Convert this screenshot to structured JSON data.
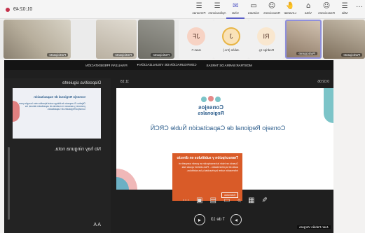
{
  "toolbar": {
    "items": [
      {
        "icon": "☰",
        "label": "Más"
      },
      {
        "icon": "☺",
        "label": "Reacciones"
      },
      {
        "icon": "⌂",
        "label": "Vista"
      },
      {
        "icon": "✋",
        "label": "Levantar"
      },
      {
        "icon": "☺",
        "label": "Reacciones"
      },
      {
        "icon": "▭",
        "label": "Cámara"
      },
      {
        "icon": "✉",
        "label": "Chat"
      },
      {
        "icon": "☰",
        "label": "Aplicaciones"
      },
      {
        "icon": "☰",
        "label": "Personas"
      }
    ],
    "more": "···",
    "timer": "01:02:49",
    "share_label": "Compartir",
    "leave_label": "Salir"
  },
  "participants": [
    {
      "type": "avatar",
      "initials": "JF",
      "name": "Juan F."
    },
    {
      "type": "avatar",
      "initials": "J",
      "name": "Julián (Inv.)"
    },
    {
      "type": "avatar",
      "initials": "RI",
      "name": "Rodrigo Ig."
    },
    {
      "type": "video",
      "name": "Participante"
    },
    {
      "type": "video",
      "name": "Participante"
    },
    {
      "type": "video",
      "name": "Participante"
    },
    {
      "type": "video",
      "name": "Participante"
    },
    {
      "type": "video",
      "name": "Participante"
    }
  ],
  "stage": {
    "tabs": [
      "MOSTRAR BARRA DE TAREAS",
      "CONFIGURACIÓN DE VISUALIZACIÓN ▾",
      "FINALIZAR PRESENTACIÓN"
    ],
    "elapsed": "0:02:06",
    "clock": "11:18",
    "slide_title": "Consejo Regional de Capacitación Ñuble CRCÑ",
    "logo_text": "Consejos Regionales de Capacitación",
    "popup_title": "Transcripción y subtítulos en directo",
    "popup_body": "Cuando se inicie la transcripción se puede compartir el audio de la presentación... Para obtener ayuda más información sobre la privacidad y los subtítulos.",
    "popup_button": "Entendido",
    "next_label": "Diapositiva siguiente",
    "next_title": "Consejo Regional de Capacitación",
    "next_body": "Objetivo: Es espacio de diálogo social tripartito entre la región para promover y asesorar en materias de capacitación laboral, los Consejos Regionales de Capacitación.",
    "notes": "No hay ninguna nota.",
    "counter": "7 de 13",
    "self_label": "Juan Fabián Vergara"
  }
}
